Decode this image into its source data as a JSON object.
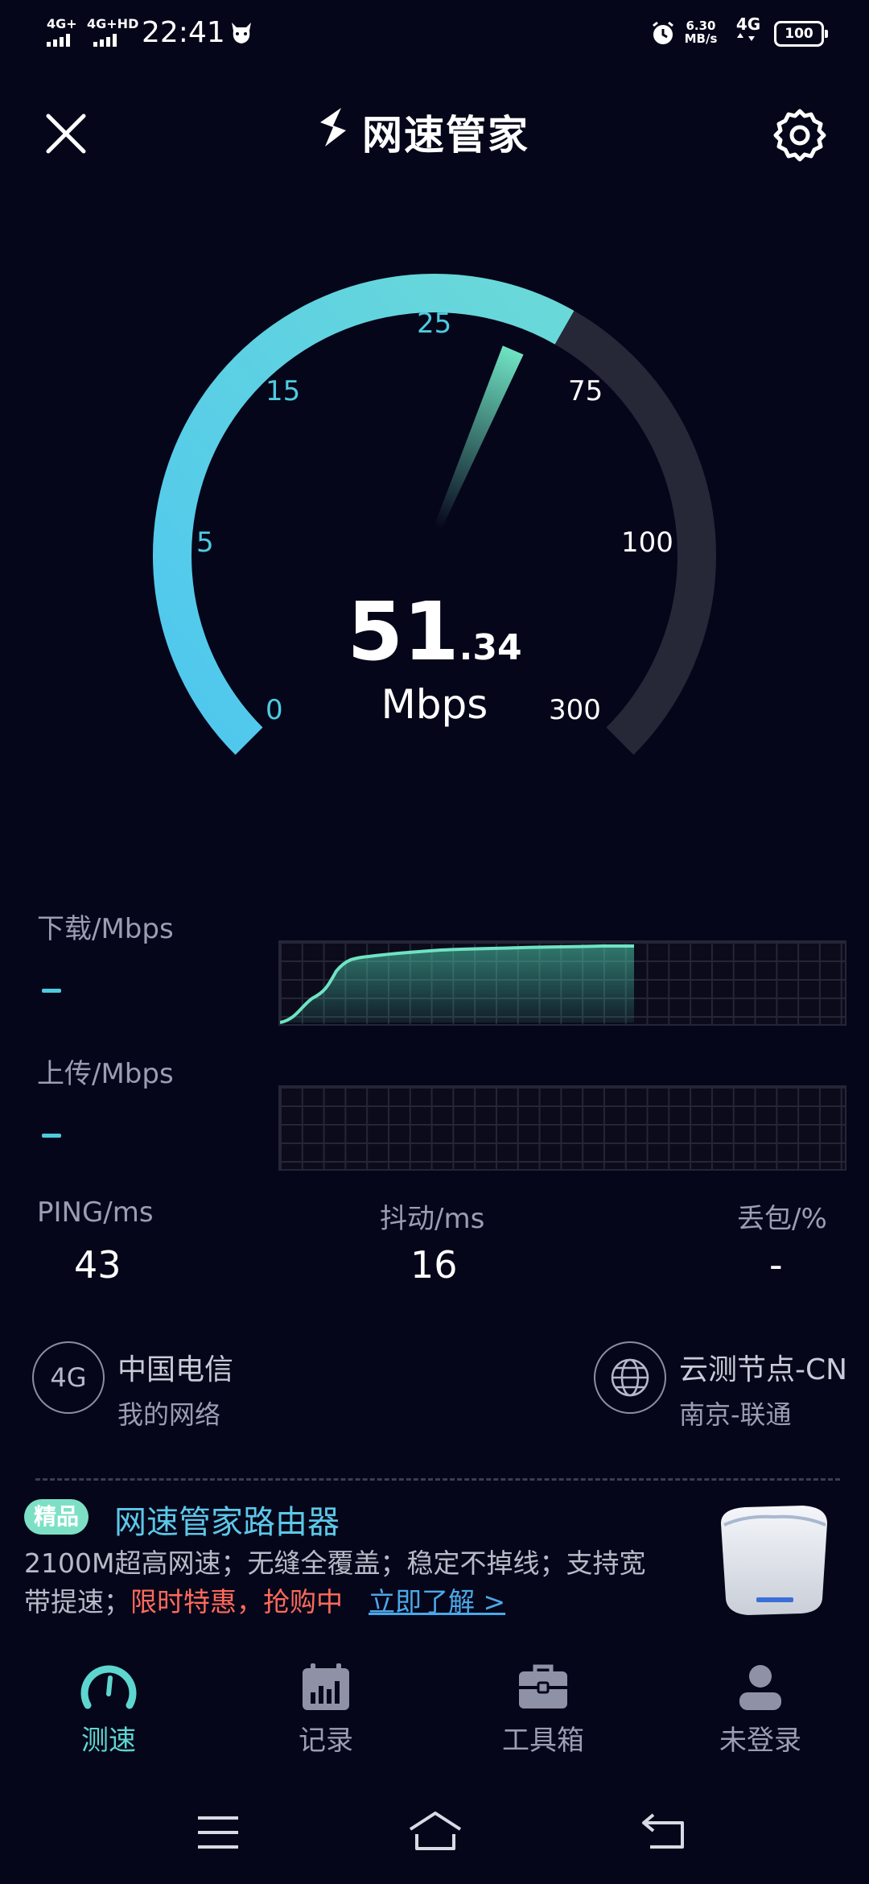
{
  "status_bar": {
    "sim1": "4G+",
    "sim2": "4G+HD",
    "time": "22:41",
    "speed_value": "6.30",
    "speed_unit": "MB/s",
    "network": "4G",
    "battery": "100"
  },
  "header": {
    "title": "网速管家",
    "close_icon": "close-icon",
    "settings_icon": "gear-icon"
  },
  "gauge": {
    "ticks": [
      "0",
      "5",
      "15",
      "25",
      "75",
      "100",
      "300"
    ],
    "speed_int": "51",
    "speed_dec": ".34",
    "unit": "Mbps",
    "progress_fraction": 0.61,
    "needle_color": "#6fe3c2",
    "arc_active_color": "#4ecbdf",
    "arc_inactive_color": "#262837"
  },
  "download": {
    "label": "下载/Mbps",
    "value": "-",
    "fill_fraction": 0.6
  },
  "upload": {
    "label": "上传/Mbps",
    "value": "-"
  },
  "stats": [
    {
      "label": "PING/ms",
      "value": "43"
    },
    {
      "label": "抖动/ms",
      "value": "16"
    },
    {
      "label": "丢包/%",
      "value": "-"
    }
  ],
  "network_info": {
    "carrier_icon": "4G",
    "carrier": "中国电信",
    "carrier_sub": "我的网络",
    "node": "云测节点-CN",
    "node_sub": "南京-联通"
  },
  "ad": {
    "badge": "精品",
    "title": "网速管家路由器",
    "line1": "2100M超高网速；无缝全覆盖；稳定不掉线；支持宽",
    "line2_prefix": "带提速；",
    "line2_highlight": "限时特惠，抢购中",
    "link": "立即了解 >"
  },
  "bottom_nav": [
    {
      "label": "测速",
      "icon": "speedometer-icon",
      "active": true
    },
    {
      "label": "记录",
      "icon": "calendar-chart-icon",
      "active": false
    },
    {
      "label": "工具箱",
      "icon": "toolbox-icon",
      "active": false
    },
    {
      "label": "未登录",
      "icon": "user-icon",
      "active": false
    }
  ],
  "system_nav": [
    "menu-icon",
    "home-icon",
    "back-icon"
  ]
}
